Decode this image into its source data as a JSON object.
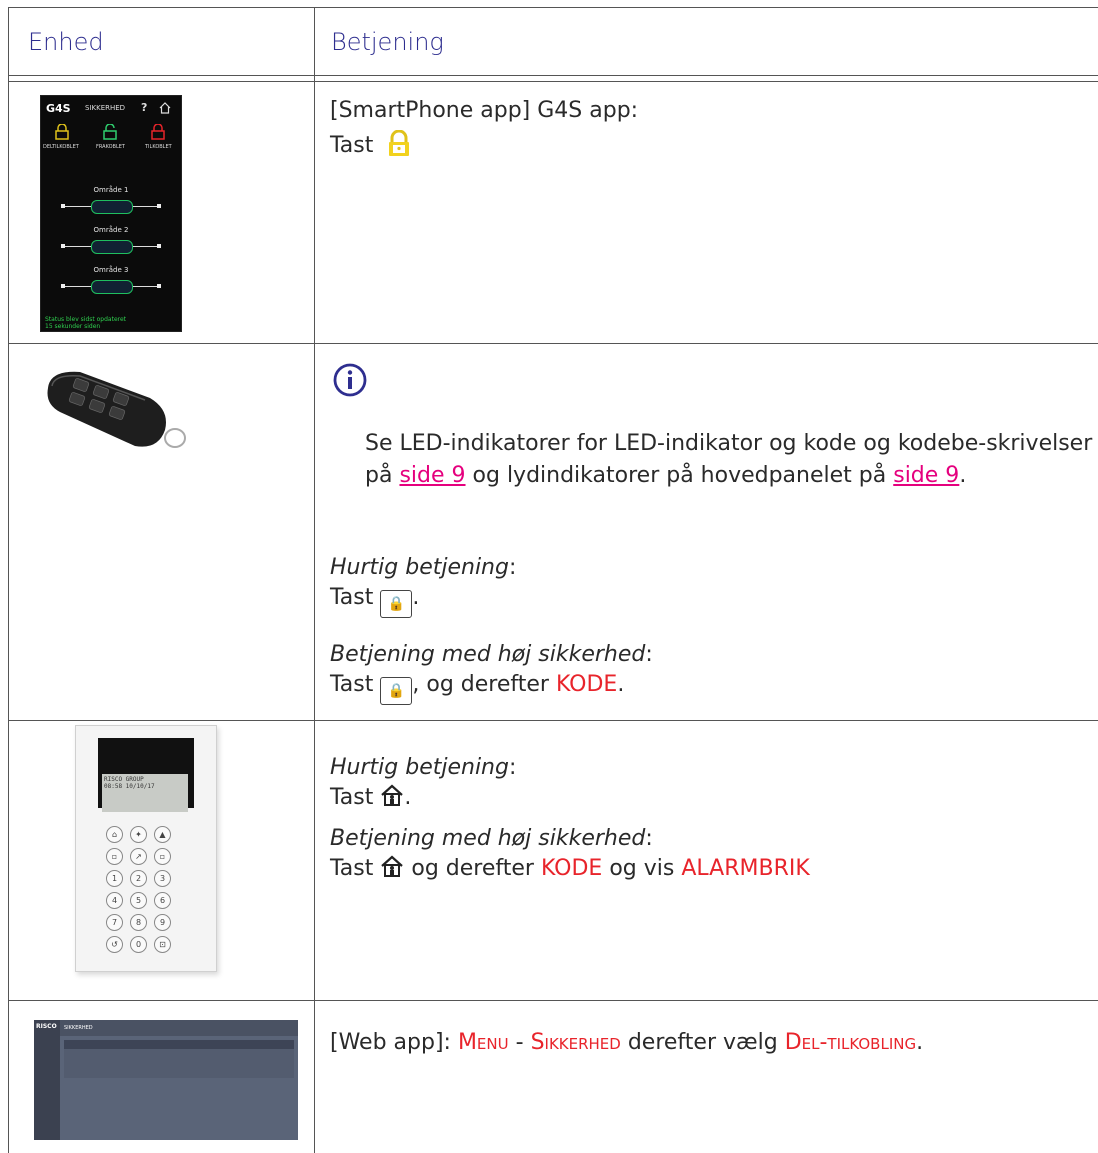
{
  "header": {
    "col1": "Enhed",
    "col2": "Betjening"
  },
  "rows": {
    "app": {
      "line1": "[SmartPhone app] G4S app:",
      "line2": "Tast",
      "phone": {
        "logo": "G4S",
        "title": "SIKKERHED",
        "help": "?",
        "labels": [
          "DELTILKOBLET",
          "FRAKOBLET",
          "TILKOBLET"
        ],
        "areas": [
          "Område 1",
          "Område 2",
          "Område 3"
        ],
        "status": [
          "Status blev sidst opdateret",
          "15 sekunder siden"
        ]
      }
    },
    "fob": {
      "note_prefix": "Se LED-indikatorer for LED-indikator og kode og kodebe-skrivelser på ",
      "link1": "side 9",
      "note_mid": " og lydindikatorer på hovedpanelet på ",
      "link2": "side 9",
      "note_end": ".",
      "quick_label": "Hurtig betjening",
      "quick_colon": ":",
      "quick_tast": "Tast",
      "quick_end": ".",
      "high_label": "Betjening med høj sikkerhed",
      "high_colon": ":",
      "high_tast": "Tast",
      "high_mid": ", og derefter ",
      "high_code": "KODE",
      "high_end": "."
    },
    "keypad": {
      "quick_label": "Hurtig betjening",
      "quick_colon": ":",
      "quick_tast": "Tast",
      "quick_end": ".",
      "high_label": "Betjening med høj sikkerhed",
      "high_colon": ":",
      "high_tast": "Tast",
      "high_mid": " og derefter ",
      "high_code": "KODE",
      "high_mid2": " og vis ",
      "high_alarm": "ALARMBRIK",
      "lcd_line1": "RISCO GROUP",
      "lcd_line2": "08:58   10/10/17",
      "keys": [
        "1",
        "2",
        "3",
        "4",
        "5",
        "6",
        "7",
        "8",
        "9",
        "0"
      ]
    },
    "web": {
      "prefix": "[Web app]: ",
      "menu": "Menu",
      "dash": " - ",
      "sikkerhed": "Sikkerhed",
      "mid": " derefter vælg ",
      "del": "Del-tilkobling",
      "end": ".",
      "brand": "RISCO",
      "title": "SIKKERHED"
    }
  },
  "colors": {
    "header_text": "#2e2e8f",
    "accent_red": "#e8242b",
    "link": "#e5007e",
    "lock_yellow": "#e0c21a"
  },
  "icons": [
    "info-icon",
    "partial-lock-icon",
    "lock-key-icon",
    "home-icon"
  ]
}
